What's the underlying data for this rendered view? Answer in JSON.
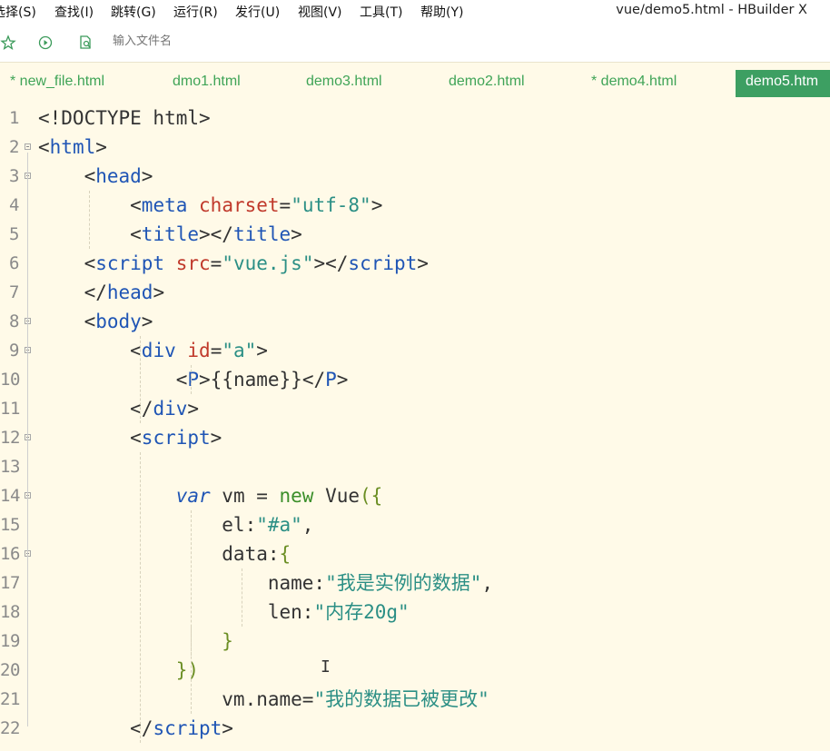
{
  "menu": {
    "items": [
      "选择(S)",
      "查找(I)",
      "跳转(G)",
      "运行(R)",
      "发行(U)",
      "视图(V)",
      "工具(T)",
      "帮助(Y)"
    ],
    "window_title": "vue/demo5.html - HBuilder X"
  },
  "toolbar": {
    "file_search_placeholder": "输入文件名",
    "icons": [
      "star-icon",
      "run-icon",
      "file-search-icon"
    ]
  },
  "tabs": [
    {
      "label": "* new_file.html",
      "active": false
    },
    {
      "label": "dmo1.html",
      "active": false
    },
    {
      "label": "demo3.html",
      "active": false
    },
    {
      "label": "demo2.html",
      "active": false
    },
    {
      "label": "* demo4.html",
      "active": false
    },
    {
      "label": "demo5.htm",
      "active": true
    }
  ],
  "editor": {
    "lines": [
      {
        "n": "1",
        "fold": false,
        "tokens": [
          [
            "plain",
            "<!DOCTYPE html>"
          ]
        ]
      },
      {
        "n": "2",
        "fold": true,
        "tokens": [
          [
            "plain",
            "<"
          ],
          [
            "tag",
            "html"
          ],
          [
            "plain",
            ">"
          ]
        ]
      },
      {
        "n": "3",
        "fold": true,
        "tokens": [
          [
            "plain",
            "    <"
          ],
          [
            "tag",
            "head"
          ],
          [
            "plain",
            ">"
          ]
        ]
      },
      {
        "n": "4",
        "fold": false,
        "tokens": [
          [
            "plain",
            "        <"
          ],
          [
            "tag",
            "meta"
          ],
          [
            "plain",
            " "
          ],
          [
            "attr",
            "charset"
          ],
          [
            "plain",
            "="
          ],
          [
            "str",
            "\"utf-8\""
          ],
          [
            "plain",
            ">"
          ]
        ]
      },
      {
        "n": "5",
        "fold": false,
        "tokens": [
          [
            "plain",
            "        <"
          ],
          [
            "tag",
            "title"
          ],
          [
            "plain",
            "></"
          ],
          [
            "tag",
            "title"
          ],
          [
            "plain",
            ">"
          ]
        ]
      },
      {
        "n": "6",
        "fold": false,
        "tokens": [
          [
            "plain",
            "    <"
          ],
          [
            "tag",
            "script"
          ],
          [
            "plain",
            " "
          ],
          [
            "attr",
            "src"
          ],
          [
            "plain",
            "="
          ],
          [
            "str",
            "\"vue.js\""
          ],
          [
            "plain",
            "></"
          ],
          [
            "tag",
            "script"
          ],
          [
            "plain",
            ">"
          ]
        ]
      },
      {
        "n": "7",
        "fold": false,
        "tokens": [
          [
            "plain",
            "    </"
          ],
          [
            "tag",
            "head"
          ],
          [
            "plain",
            ">"
          ]
        ]
      },
      {
        "n": "8",
        "fold": true,
        "tokens": [
          [
            "plain",
            "    <"
          ],
          [
            "tag",
            "body"
          ],
          [
            "plain",
            ">"
          ]
        ]
      },
      {
        "n": "9",
        "fold": true,
        "tokens": [
          [
            "plain",
            "        <"
          ],
          [
            "tag",
            "div"
          ],
          [
            "plain",
            " "
          ],
          [
            "attr",
            "id"
          ],
          [
            "plain",
            "="
          ],
          [
            "str",
            "\"a\""
          ],
          [
            "plain",
            ">"
          ]
        ]
      },
      {
        "n": "10",
        "fold": false,
        "tokens": [
          [
            "plain",
            "            <"
          ],
          [
            "tag",
            "P"
          ],
          [
            "plain",
            ">{{name}}</"
          ],
          [
            "tag",
            "P"
          ],
          [
            "plain",
            ">"
          ]
        ]
      },
      {
        "n": "11",
        "fold": false,
        "tokens": [
          [
            "plain",
            "        </"
          ],
          [
            "tag",
            "div"
          ],
          [
            "plain",
            ">"
          ]
        ]
      },
      {
        "n": "12",
        "fold": true,
        "tokens": [
          [
            "plain",
            "        <"
          ],
          [
            "tag",
            "script"
          ],
          [
            "plain",
            ">"
          ]
        ]
      },
      {
        "n": "13",
        "fold": false,
        "tokens": []
      },
      {
        "n": "14",
        "fold": true,
        "tokens": [
          [
            "plain",
            "            "
          ],
          [
            "kw",
            "var"
          ],
          [
            "plain",
            " vm = "
          ],
          [
            "new",
            "new"
          ],
          [
            "plain",
            " Vue"
          ],
          [
            "brace",
            "({"
          ]
        ]
      },
      {
        "n": "15",
        "fold": false,
        "tokens": [
          [
            "plain",
            "                el:"
          ],
          [
            "str",
            "\"#a\""
          ],
          [
            "plain",
            ","
          ]
        ]
      },
      {
        "n": "16",
        "fold": true,
        "tokens": [
          [
            "plain",
            "                data:"
          ],
          [
            "brace",
            "{"
          ]
        ]
      },
      {
        "n": "17",
        "fold": false,
        "tokens": [
          [
            "plain",
            "                    name:"
          ],
          [
            "str",
            "\"我是实例的数据\""
          ],
          [
            "plain",
            ","
          ]
        ]
      },
      {
        "n": "18",
        "fold": false,
        "tokens": [
          [
            "plain",
            "                    len:"
          ],
          [
            "str",
            "\"内存20g\""
          ]
        ]
      },
      {
        "n": "19",
        "fold": false,
        "tokens": [
          [
            "plain",
            "                "
          ],
          [
            "brace",
            "}"
          ]
        ]
      },
      {
        "n": "20",
        "fold": false,
        "tokens": [
          [
            "plain",
            "            "
          ],
          [
            "brace",
            "})"
          ]
        ]
      },
      {
        "n": "21",
        "fold": false,
        "tokens": [
          [
            "plain",
            "                vm.name="
          ],
          [
            "str",
            "\"我的数据已被更改\""
          ]
        ]
      },
      {
        "n": "22",
        "fold": false,
        "tokens": [
          [
            "plain",
            "        </"
          ],
          [
            "tag",
            "script"
          ],
          [
            "plain",
            ">"
          ]
        ]
      }
    ]
  }
}
